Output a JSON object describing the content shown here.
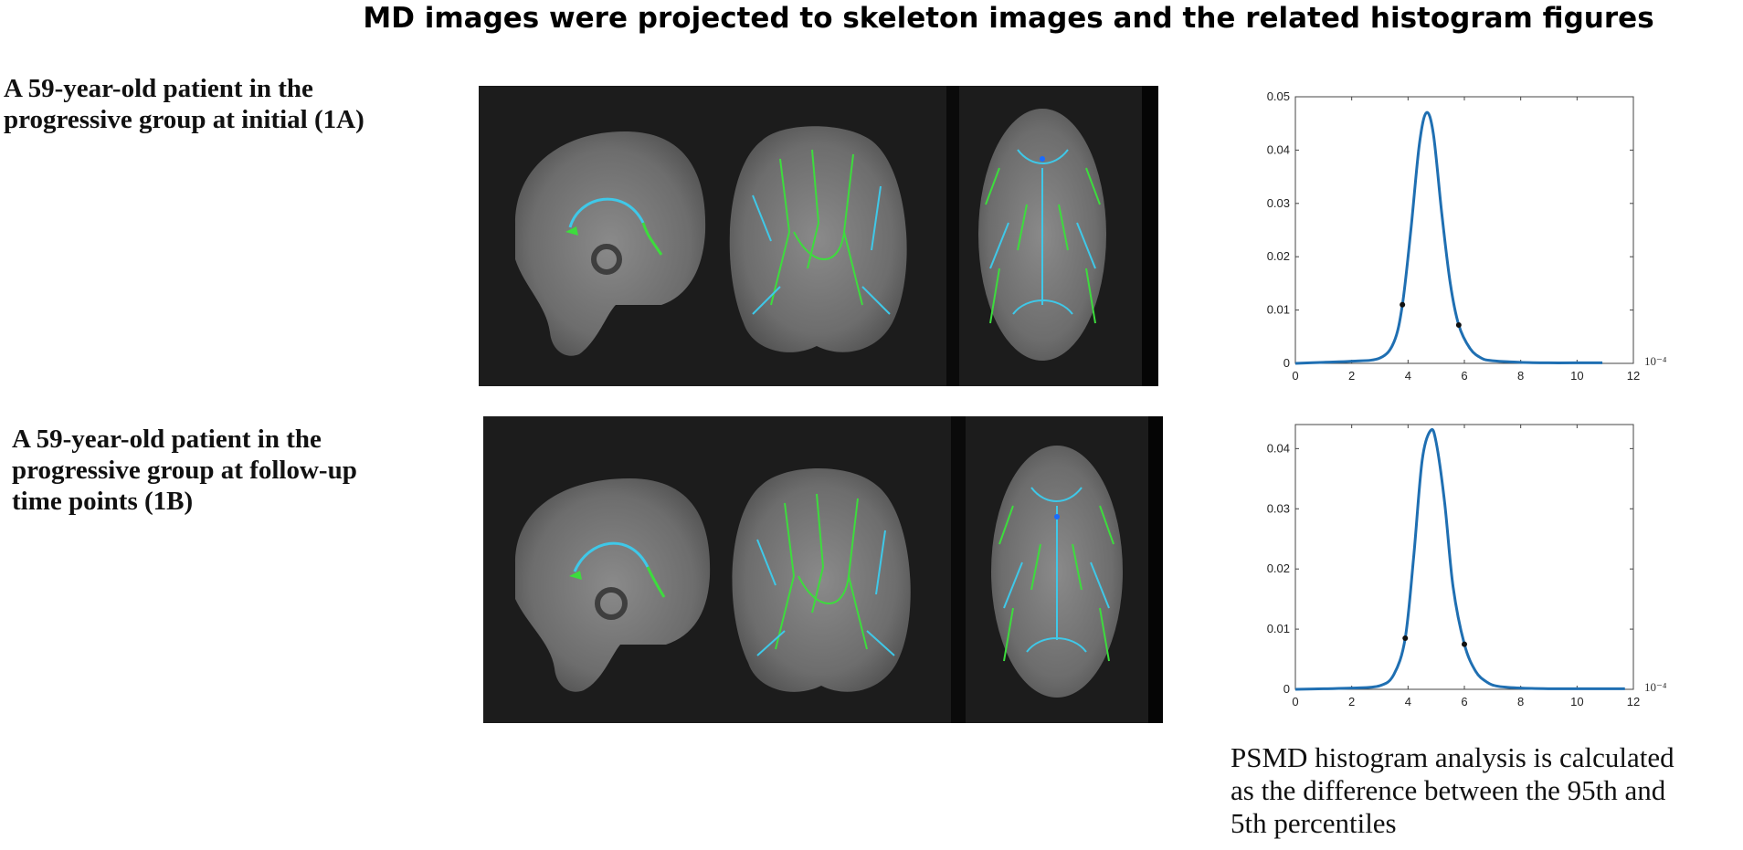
{
  "title": "MD images were projected to skeleton images and the related histogram figures",
  "rows": [
    {
      "caption_lines": [
        "A 59-year-old patient in the",
        "progressive group at initial (1A)"
      ]
    },
    {
      "caption_lines": [
        "A 59-year-old patient in the",
        "progressive group at follow-up",
        "time points (1B)"
      ]
    }
  ],
  "note_lines": [
    "PSMD histogram analysis  is calculated",
    "as the difference between the 95th and",
    "5th percentiles"
  ],
  "colors": {
    "curve": "#1f6fb2",
    "skeleton_green": "#3ddc3d",
    "skeleton_cyan": "#3fc8e8",
    "brain_bg": "#1c1c1c"
  },
  "chart_data": [
    {
      "type": "line",
      "x_scale_label": "10⁻⁴",
      "xlim": [
        0,
        12
      ],
      "ylim": [
        0,
        0.05
      ],
      "xticks": [
        "0",
        "2",
        "4",
        "6",
        "8",
        "10",
        "12"
      ],
      "yticks": [
        "0",
        "0.01",
        "0.02",
        "0.03",
        "0.04",
        "0.05"
      ],
      "series": [
        {
          "x": [
            0,
            1,
            2,
            3,
            3.5,
            3.8,
            4.1,
            4.4,
            4.65,
            4.9,
            5.2,
            5.5,
            5.8,
            6.2,
            6.6,
            7,
            8,
            9,
            10,
            10.9
          ],
          "y": [
            0,
            0.0002,
            0.0004,
            0.001,
            0.004,
            0.011,
            0.025,
            0.041,
            0.047,
            0.043,
            0.028,
            0.015,
            0.0072,
            0.0028,
            0.001,
            0.0005,
            0.0002,
            0.0001,
            0.0001,
            0.0001
          ]
        }
      ],
      "markers": [
        {
          "x": 3.8,
          "y": 0.011
        },
        {
          "x": 5.8,
          "y": 0.0072
        }
      ]
    },
    {
      "type": "line",
      "x_scale_label": "10⁻⁴",
      "xlim": [
        0,
        12
      ],
      "ylim": [
        0,
        0.044
      ],
      "xticks": [
        "0",
        "2",
        "4",
        "6",
        "8",
        "10",
        "12"
      ],
      "yticks": [
        "0",
        "0.01",
        "0.02",
        "0.03",
        "0.04"
      ],
      "series": [
        {
          "x": [
            0,
            1,
            2,
            3,
            3.5,
            3.9,
            4.2,
            4.5,
            4.8,
            5.0,
            5.3,
            5.6,
            6.0,
            6.4,
            6.8,
            7.2,
            8,
            9,
            10,
            11.7
          ],
          "y": [
            0,
            0.0001,
            0.0002,
            0.0006,
            0.0025,
            0.0085,
            0.022,
            0.038,
            0.043,
            0.041,
            0.031,
            0.017,
            0.0075,
            0.003,
            0.0012,
            0.0005,
            0.0002,
            0.0001,
            0.0001,
            0.0001
          ]
        }
      ],
      "markers": [
        {
          "x": 3.9,
          "y": 0.0085
        },
        {
          "x": 6.0,
          "y": 0.0075
        }
      ]
    }
  ]
}
